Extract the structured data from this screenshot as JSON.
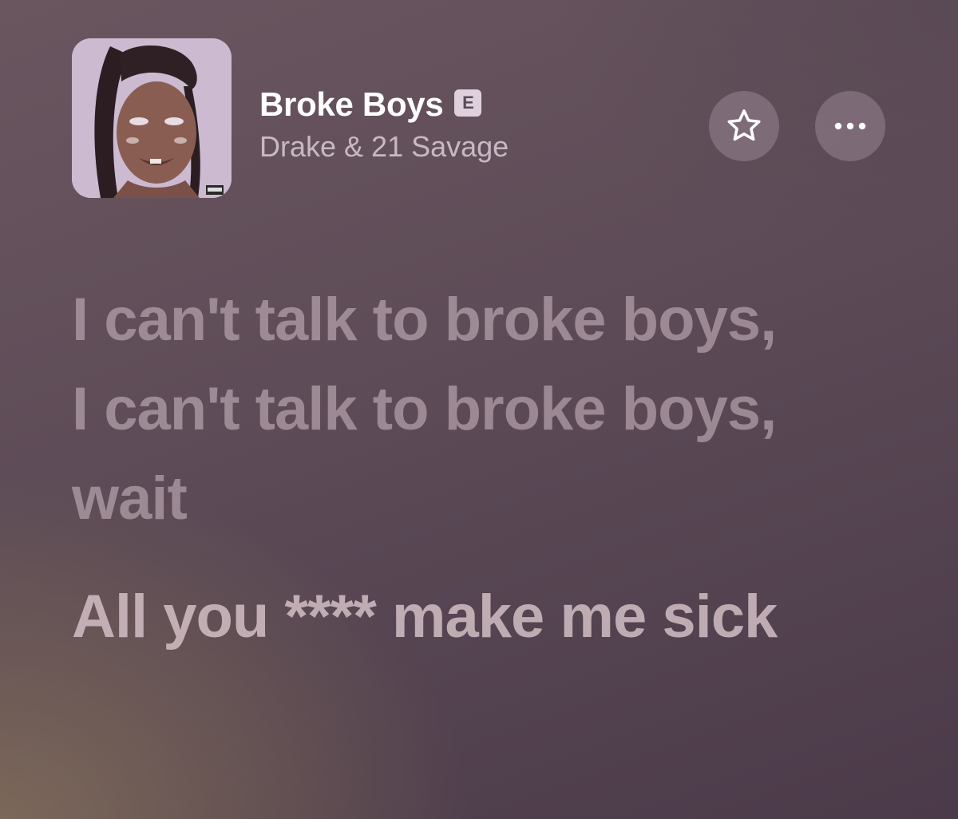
{
  "now_playing": {
    "title": "Broke Boys",
    "explicit_badge": "E",
    "artist": "Drake & 21 Savage",
    "album_art_icon": "album-cover"
  },
  "actions": {
    "favorite_icon": "star-outline-icon",
    "more_icon": "ellipsis-icon"
  },
  "lyrics": [
    "I can't talk to broke boys, I can't talk to broke boys, wait",
    "All you **** make me sick"
  ],
  "colors": {
    "background_top": "#6a565f",
    "background_bottom": "#4b3a49",
    "accent_warm": "#7c6859",
    "title": "#ffffff",
    "explicit_badge_bg": "#ecdeec"
  }
}
